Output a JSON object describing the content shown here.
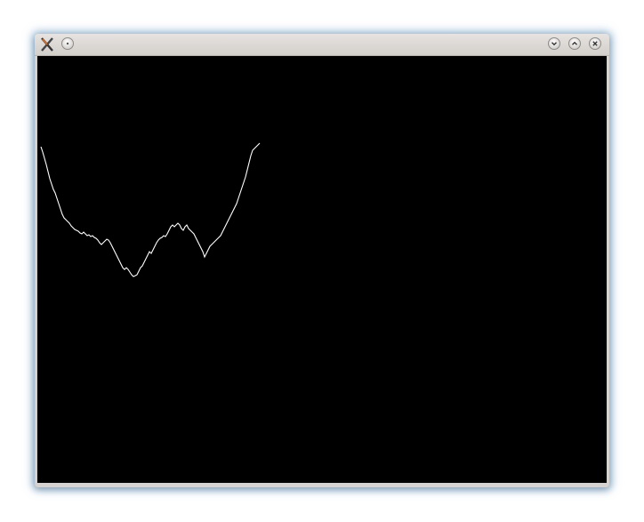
{
  "window": {
    "title": "",
    "buttons": {
      "menu": "menu",
      "minimize": "minimize",
      "maximize": "maximize",
      "close": "close"
    }
  },
  "canvas": {
    "background": "#000000",
    "stroke": "#ffffff"
  },
  "icons": {
    "app": "xapp-icon",
    "menu": "circle-icon",
    "minimize": "chevron-down-icon",
    "maximize": "chevron-up-icon",
    "close": "close-icon"
  }
}
